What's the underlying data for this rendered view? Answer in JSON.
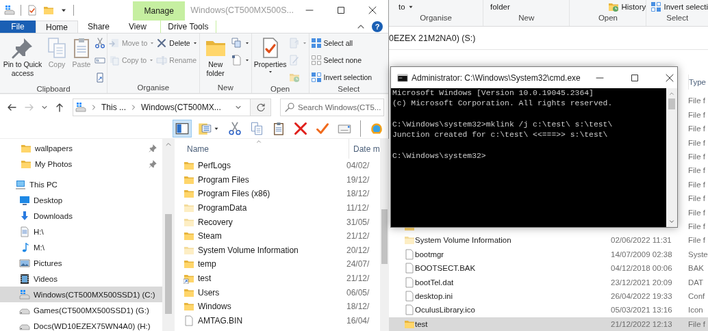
{
  "explorer": {
    "context_tab": "Manage",
    "title": "Windows(CT500MX500S...",
    "tabs": [
      {
        "label": "File",
        "kind": "file",
        "selected": false
      },
      {
        "label": "Home",
        "kind": "tab",
        "selected": true
      },
      {
        "label": "Share",
        "kind": "tab",
        "selected": false
      },
      {
        "label": "View",
        "kind": "tab",
        "selected": false
      },
      {
        "label": "Drive Tools",
        "kind": "context",
        "selected": false
      }
    ],
    "help": "?",
    "ribbon": [
      {
        "label": "Clipboard",
        "items": [
          {
            "kind": "pin",
            "label": "Pin to Quick access",
            "disabled": false
          },
          {
            "kind": "copy",
            "label": "Copy",
            "disabled": true
          },
          {
            "kind": "paste",
            "label": "Paste",
            "disabled": true
          },
          {
            "column": [
              {
                "kind": "cut",
                "disabled": false
              },
              {
                "kind": "copy-path",
                "disabled": false
              },
              {
                "kind": "paste-shortcut",
                "disabled": false
              }
            ]
          }
        ]
      },
      {
        "label": "Organise",
        "items": [
          {
            "column": [
              {
                "kind": "move",
                "label": "Move to",
                "dropdown": true,
                "disabled": true
              },
              {
                "kind": "copy-to",
                "label": "Copy to",
                "dropdown": true,
                "disabled": true
              }
            ]
          },
          {
            "column": [
              {
                "kind": "delete",
                "label": "Delete",
                "dropdown": true,
                "disabled": false
              },
              {
                "kind": "rename",
                "label": "Rename",
                "disabled": true
              }
            ]
          }
        ]
      },
      {
        "label": "New",
        "items": [
          {
            "kind": "new-folder",
            "label": "New folder",
            "disabled": false
          },
          {
            "column": [
              {
                "kind": "new-item",
                "dropdown": true,
                "disabled": false
              },
              {
                "kind": "easy-access",
                "dropdown": true,
                "disabled": false
              }
            ]
          }
        ]
      },
      {
        "label": "Open",
        "items": [
          {
            "kind": "properties",
            "label": "Properties",
            "dropdown": true,
            "disabled": false
          },
          {
            "column": [
              {
                "kind": "open",
                "dropdown": true,
                "disabled": true
              },
              {
                "kind": "edit",
                "disabled": true
              },
              {
                "kind": "history",
                "disabled": true
              }
            ]
          }
        ]
      },
      {
        "label": "Select",
        "items": [
          {
            "column": [
              {
                "kind": "select-all",
                "label": "Select all",
                "disabled": false
              },
              {
                "kind": "select-none",
                "label": "Select none",
                "disabled": false
              },
              {
                "kind": "invert",
                "label": "Invert selection",
                "disabled": false
              }
            ]
          }
        ]
      }
    ],
    "nav": {
      "back": {
        "disabled": false
      },
      "forward": {
        "disabled": true
      }
    },
    "address": {
      "crumbs": [
        "This ...",
        "Windows(CT500MX..."
      ]
    },
    "search": {
      "placeholder": "Search Windows(CT5..."
    },
    "toolbar": [
      {
        "kind": "pane",
        "selected": true
      },
      {
        "kind": "folder-list",
        "dropdown": true,
        "selected": false
      },
      {
        "kind": "cut",
        "selected": false
      },
      {
        "kind": "copy",
        "selected": false
      },
      {
        "kind": "paste",
        "selected": false
      },
      {
        "kind": "delete-red",
        "selected": false
      },
      {
        "kind": "check",
        "selected": false
      },
      {
        "kind": "mail",
        "selected": false
      },
      {
        "kind": "shell",
        "selected": false
      }
    ],
    "tree": [
      {
        "label": "wallpapers",
        "kind": "folder",
        "pinned": true,
        "selected": false
      },
      {
        "label": "My Photos",
        "kind": "folder",
        "pinned": true,
        "selected": false
      },
      {
        "label": "This PC",
        "kind": "computer",
        "pinned": false,
        "selected": false,
        "children": [
          {
            "label": "Desktop",
            "kind": "desktop",
            "pinned": false,
            "selected": false
          },
          {
            "label": "Downloads",
            "kind": "download",
            "pinned": false,
            "selected": false
          },
          {
            "label": "H:\\",
            "kind": "document",
            "pinned": false,
            "selected": false
          },
          {
            "label": "M:\\",
            "kind": "music",
            "pinned": false,
            "selected": false
          },
          {
            "label": "Pictures",
            "kind": "picture",
            "pinned": false,
            "selected": false
          },
          {
            "label": "Videos",
            "kind": "video",
            "pinned": false,
            "selected": false
          },
          {
            "label": "Windows(CT500MX500SSD1) (C:)",
            "kind": "drive-win",
            "pinned": false,
            "selected": true
          },
          {
            "label": "Games(CT500MX500SSD1) (G:)",
            "kind": "drive",
            "pinned": false,
            "selected": false
          },
          {
            "label": "Docs(WD10EZEX75WN4A0) (H:)",
            "kind": "drive",
            "pinned": false,
            "selected": false
          }
        ]
      }
    ],
    "columns": [
      "Name",
      "Date m"
    ],
    "files": [
      {
        "name": "PerfLogs",
        "date": "04/02/",
        "kind": "folder",
        "selected": false
      },
      {
        "name": "Program Files",
        "date": "19/12/",
        "kind": "folder",
        "selected": false
      },
      {
        "name": "Program Files (x86)",
        "date": "18/12/",
        "kind": "folder",
        "selected": false
      },
      {
        "name": "ProgramData",
        "date": "11/12/",
        "kind": "folder-pale",
        "selected": false
      },
      {
        "name": "Recovery",
        "date": "31/05/",
        "kind": "folder-pale",
        "selected": false
      },
      {
        "name": "Steam",
        "date": "21/12/",
        "kind": "folder",
        "selected": false
      },
      {
        "name": "System Volume Information",
        "date": "20/12/",
        "kind": "folder-pale",
        "selected": false
      },
      {
        "name": "temp",
        "date": "24/07/",
        "kind": "folder",
        "selected": false
      },
      {
        "name": "test",
        "date": "21/12/",
        "kind": "folder-link",
        "selected": false
      },
      {
        "name": "Users",
        "date": "06/05/",
        "kind": "folder",
        "selected": false
      },
      {
        "name": "Windows",
        "date": "18/12/",
        "kind": "folder",
        "selected": false
      },
      {
        "name": "AMTAG.BIN",
        "date": "16/04/",
        "kind": "file",
        "selected": false
      }
    ]
  },
  "background_explorer": {
    "ribbon": [
      {
        "label": "Organise",
        "buttons": [
          {
            "label": "to",
            "dropdown": true
          }
        ]
      },
      {
        "label": "New",
        "buttons": [
          {
            "label": "folder"
          }
        ]
      },
      {
        "label": "Open",
        "buttons": [
          {
            "kind": "history",
            "label": "History"
          }
        ]
      },
      {
        "label": "Select",
        "buttons": [
          {
            "kind": "invert",
            "label": "Invert selecti"
          }
        ]
      }
    ],
    "address": "0EZEX 21M2NA0) (S:)",
    "columns": [
      "Type"
    ],
    "files": [
      {
        "type": "File f",
        "selected": false
      },
      {
        "type": "File f",
        "selected": false
      },
      {
        "type": "File f",
        "selected": false
      },
      {
        "type": "File f",
        "selected": false
      },
      {
        "type": "File f",
        "selected": false
      },
      {
        "type": "File f",
        "selected": false
      },
      {
        "type": "File f",
        "selected": false
      },
      {
        "type": "File f",
        "selected": false
      },
      {
        "type": "File f",
        "selected": false
      },
      {
        "type": "File f",
        "kind": "folder",
        "selected": false
      },
      {
        "name": "System Volume Information",
        "date": "02/06/2022 11:31",
        "type": "File f",
        "kind": "folder-pale",
        "selected": false
      },
      {
        "name": "bootmgr",
        "date": "14/07/2009 02:38",
        "type": "Syste",
        "kind": "file",
        "selected": false
      },
      {
        "name": "BOOTSECT.BAK",
        "date": "04/12/2018 00:06",
        "type": "BAK",
        "kind": "file",
        "selected": false
      },
      {
        "name": "bootTel.dat",
        "date": "23/12/2021 20:09",
        "type": "DAT",
        "kind": "file",
        "selected": false
      },
      {
        "name": "desktop.ini",
        "date": "26/04/2022 19:33",
        "type": "Conf",
        "kind": "file",
        "selected": false
      },
      {
        "name": "OculusLibrary.ico",
        "date": "05/03/2021 13:16",
        "type": "Icon",
        "kind": "file",
        "selected": false
      },
      {
        "name": "test",
        "date": "21/12/2022 12:13",
        "type": "File f",
        "kind": "folder",
        "selected": true
      }
    ]
  },
  "console": {
    "title": "Administrator: C:\\Windows\\System32\\cmd.exe",
    "blocks": [
      [
        "Microsoft Windows [Version 10.0.19045.2364]",
        "(c) Microsoft Corporation. All rights reserved."
      ],
      [
        "C:\\Windows\\system32>mklink /j c:\\test\\ s:\\test\\",
        "Junction created for c:\\test\\ <<===>> s:\\test\\"
      ],
      [
        "C:\\Windows\\system32>"
      ]
    ]
  }
}
